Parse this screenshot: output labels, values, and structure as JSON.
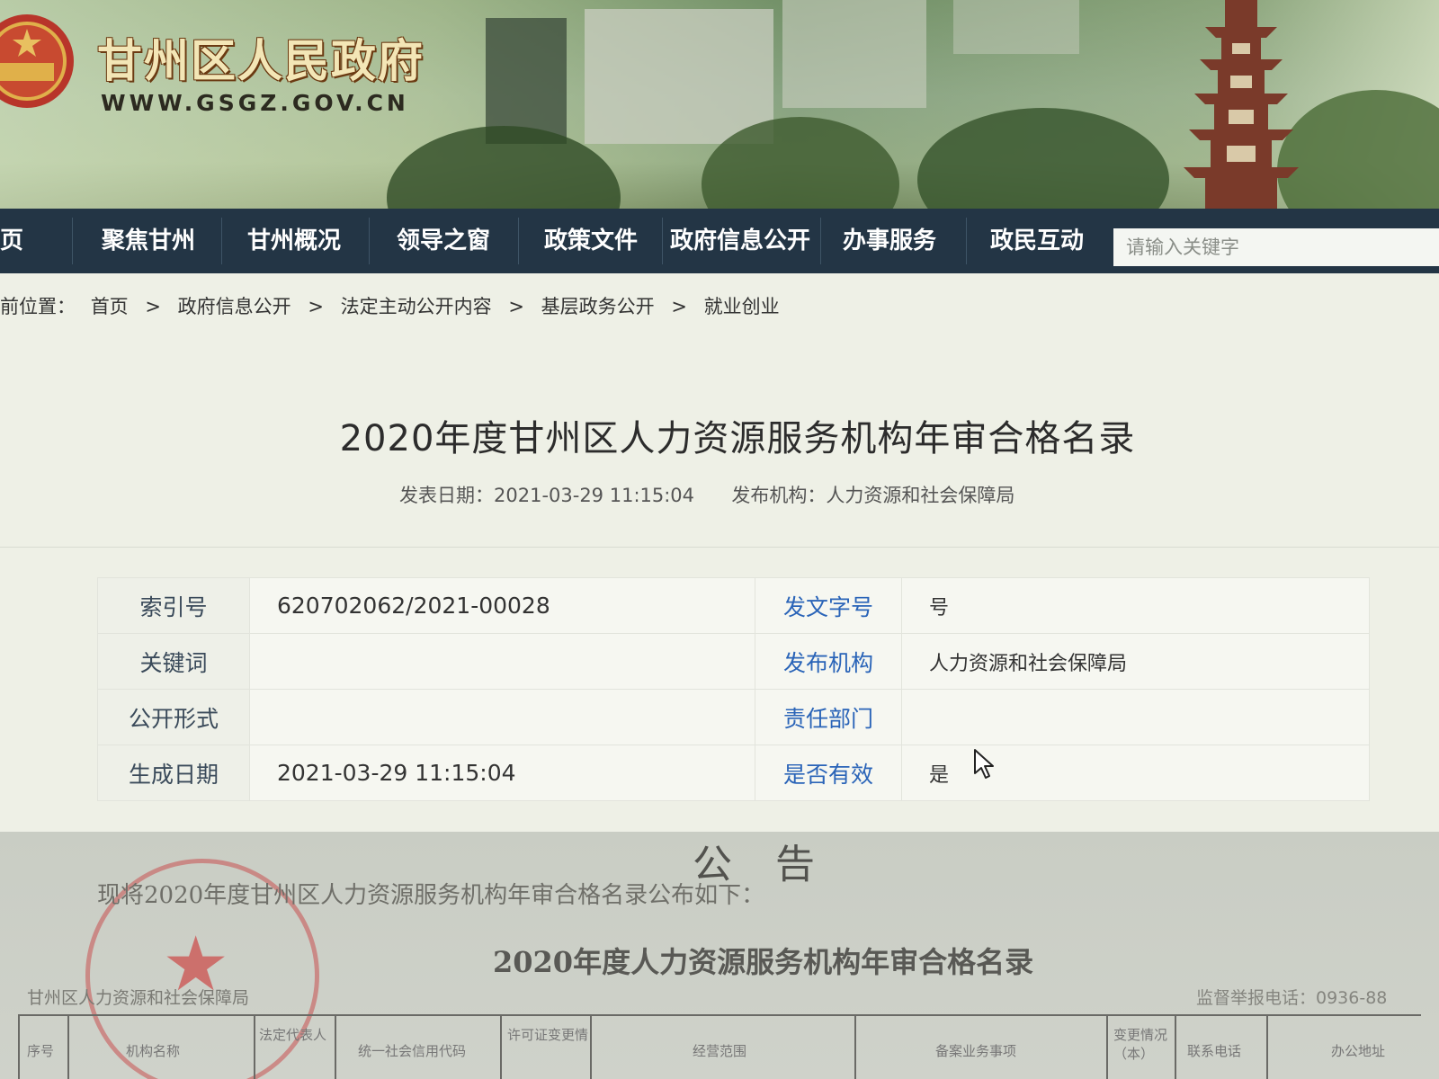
{
  "header": {
    "site_title": "甘州区人民政府",
    "site_url": "WWW.GSGZ.GOV.CN",
    "emblem_icon": "national-emblem-icon"
  },
  "nav": {
    "items": [
      {
        "label": "页"
      },
      {
        "label": "聚焦甘州"
      },
      {
        "label": "甘州概况"
      },
      {
        "label": "领导之窗"
      },
      {
        "label": "政策文件"
      },
      {
        "label": "政府信息公开"
      },
      {
        "label": "办事服务"
      },
      {
        "label": "政民互动"
      }
    ],
    "search_placeholder": "请输入关键字"
  },
  "breadcrumb": {
    "prefix": "前位置：",
    "items": [
      "首页",
      "政府信息公开",
      "法定主动公开内容",
      "基层政务公开",
      "就业创业"
    ],
    "separator": ">"
  },
  "article": {
    "title": "2020年度甘州区人力资源服务机构年审合格名录",
    "publish_date_label": "发表日期：",
    "publish_date": "2021-03-29 11:15:04",
    "publisher_label": "发布机构：",
    "publisher": "人力资源和社会保障局"
  },
  "info": {
    "index_label": "索引号",
    "index_value": "620702062/2021-00028",
    "keywords_label": "关键词",
    "keywords_value": "",
    "public_form_label": "公开形式",
    "public_form_value": "",
    "created_label": "生成日期",
    "created_value": "2021-03-29 11:15:04",
    "doc_number_label": "发文字号",
    "doc_number_value": "号",
    "issuer_label": "发布机构",
    "issuer_value": "人力资源和社会保障局",
    "dept_label": "责任部门",
    "dept_value": "",
    "valid_label": "是否有效",
    "valid_value": "是"
  },
  "notice": {
    "heading": "公告",
    "line1": "现将2020年度甘州区人力资源服务机构年审合格名录公布如下：",
    "subtitle": "2020年度人力资源服务机构年审合格名录",
    "org": "甘州区人力资源和社会保障局",
    "phone": "监督举报电话：0936-88",
    "columns": [
      "序号",
      "机构名称",
      "法定代表人",
      "统一社会信用代码",
      "许可证变更情",
      "经营范围",
      "备案业务事项",
      "变更情况（本）",
      "联系电话",
      "办公地址"
    ],
    "stamp_color": "#c85050"
  },
  "colors": {
    "nav_bg": "#233545",
    "link_blue": "#2a64b8",
    "title_gold": "#f3e6b6"
  }
}
